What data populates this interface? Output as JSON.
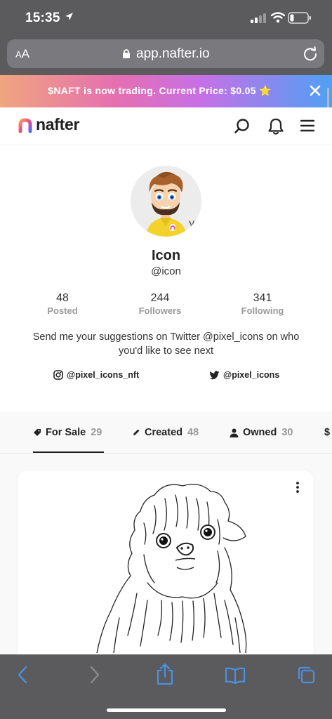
{
  "status_bar": {
    "time": "15:35"
  },
  "address_bar": {
    "aa_label_small": "A",
    "aa_label_large": "A",
    "url": "app.nafter.io"
  },
  "promo": {
    "text": "$NAFT is now trading. Current Price: $0.05 ⭐"
  },
  "nav": {
    "logo_text": "nafter"
  },
  "profile": {
    "name": "Icon",
    "handle": "@icon",
    "stats": [
      {
        "value": "48",
        "label": "Posted"
      },
      {
        "value": "244",
        "label": "Followers"
      },
      {
        "value": "341",
        "label": "Following"
      }
    ],
    "bio": "Send me your suggestions on Twitter @pixel_icons on who you'd like to see next",
    "instagram": "@pixel_icons_nft",
    "twitter": "@pixel_icons"
  },
  "tabs": [
    {
      "label": "For Sale",
      "count": "29"
    },
    {
      "label": "Created",
      "count": "48"
    },
    {
      "label": "Owned",
      "count": "30"
    },
    {
      "label": "$"
    }
  ],
  "colors": {
    "accent": "#e94a8a",
    "chrome": "#5b5b5e",
    "toolbar_icon": "#4a90e2"
  }
}
